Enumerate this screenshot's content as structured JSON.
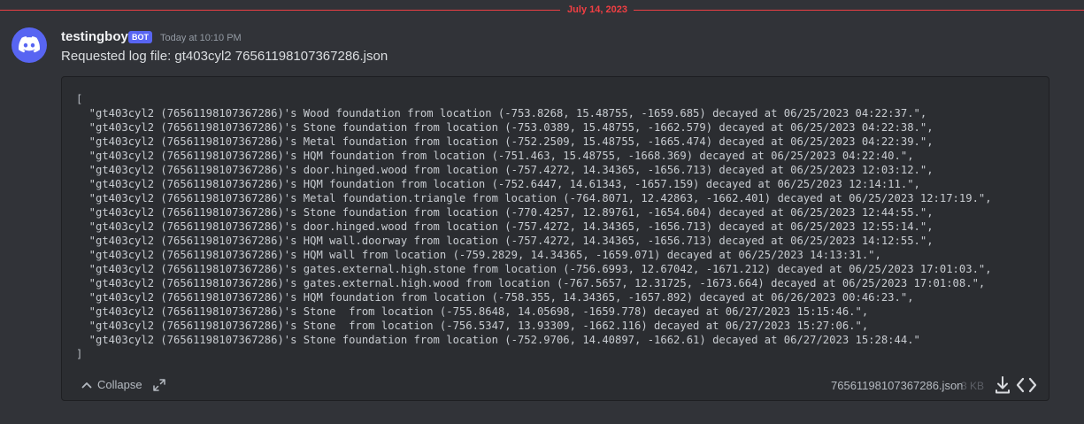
{
  "divider": {
    "date": "July 14, 2023"
  },
  "message": {
    "author": "testingboy",
    "bot_tag": "BOT",
    "timestamp": "Today at 10:10 PM",
    "text": "Requested log file: gt403cyl2 76561198107367286.json",
    "avatar_icon": "discord-logo-icon"
  },
  "attachment": {
    "open_bracket": "[",
    "close_bracket": "]",
    "lines": [
      "\"gt403cyl2 (76561198107367286)'s Wood foundation from location (-753.8268, 15.48755, -1659.685) decayed at 06/25/2023 04:22:37.\",",
      "\"gt403cyl2 (76561198107367286)'s Stone foundation from location (-753.0389, 15.48755, -1662.579) decayed at 06/25/2023 04:22:38.\",",
      "\"gt403cyl2 (76561198107367286)'s Metal foundation from location (-752.2509, 15.48755, -1665.474) decayed at 06/25/2023 04:22:39.\",",
      "\"gt403cyl2 (76561198107367286)'s HQM foundation from location (-751.463, 15.48755, -1668.369) decayed at 06/25/2023 04:22:40.\",",
      "\"gt403cyl2 (76561198107367286)'s door.hinged.wood from location (-757.4272, 14.34365, -1656.713) decayed at 06/25/2023 12:03:12.\",",
      "\"gt403cyl2 (76561198107367286)'s HQM foundation from location (-752.6447, 14.61343, -1657.159) decayed at 06/25/2023 12:14:11.\",",
      "\"gt403cyl2 (76561198107367286)'s Metal foundation.triangle from location (-764.8071, 12.42863, -1662.401) decayed at 06/25/2023 12:17:19.\",",
      "\"gt403cyl2 (76561198107367286)'s Stone foundation from location (-770.4257, 12.89761, -1654.604) decayed at 06/25/2023 12:44:55.\",",
      "\"gt403cyl2 (76561198107367286)'s door.hinged.wood from location (-757.4272, 14.34365, -1656.713) decayed at 06/25/2023 12:55:14.\",",
      "\"gt403cyl2 (76561198107367286)'s HQM wall.doorway from location (-757.4272, 14.34365, -1656.713) decayed at 06/25/2023 14:12:55.\",",
      "\"gt403cyl2 (76561198107367286)'s HQM wall from location (-759.2829, 14.34365, -1659.071) decayed at 06/25/2023 14:13:31.\",",
      "\"gt403cyl2 (76561198107367286)'s gates.external.high.stone from location (-756.6993, 12.67042, -1671.212) decayed at 06/25/2023 17:01:03.\",",
      "\"gt403cyl2 (76561198107367286)'s gates.external.high.wood from location (-767.5657, 12.31725, -1673.664) decayed at 06/25/2023 17:01:08.\",",
      "\"gt403cyl2 (76561198107367286)'s HQM foundation from location (-758.355, 14.34365, -1657.892) decayed at 06/26/2023 00:46:23.\",",
      "\"gt403cyl2 (76561198107367286)'s Stone  from location (-755.8648, 14.05698, -1659.778) decayed at 06/27/2023 15:15:46.\",",
      "\"gt403cyl2 (76561198107367286)'s Stone  from location (-756.5347, 13.93309, -1662.116) decayed at 06/27/2023 15:27:06.\",",
      "\"gt403cyl2 (76561198107367286)'s Stone foundation from location (-752.9706, 14.40897, -1662.61) decayed at 06/27/2023 15:28:44.\""
    ],
    "collapse_label": "Collapse",
    "file_name": "76561198107367286.json",
    "file_size": "3 KB"
  },
  "colors": {
    "background": "#313338",
    "attachment_bg": "#2b2d31",
    "divider_red": "#f23f43",
    "bot_tag": "#5865f2",
    "text_primary": "#f2f3f5",
    "text_muted": "#949ba4"
  },
  "icons": [
    "discord-logo-icon",
    "chevron-up-icon",
    "expand-icon",
    "download-icon",
    "code-icon"
  ]
}
